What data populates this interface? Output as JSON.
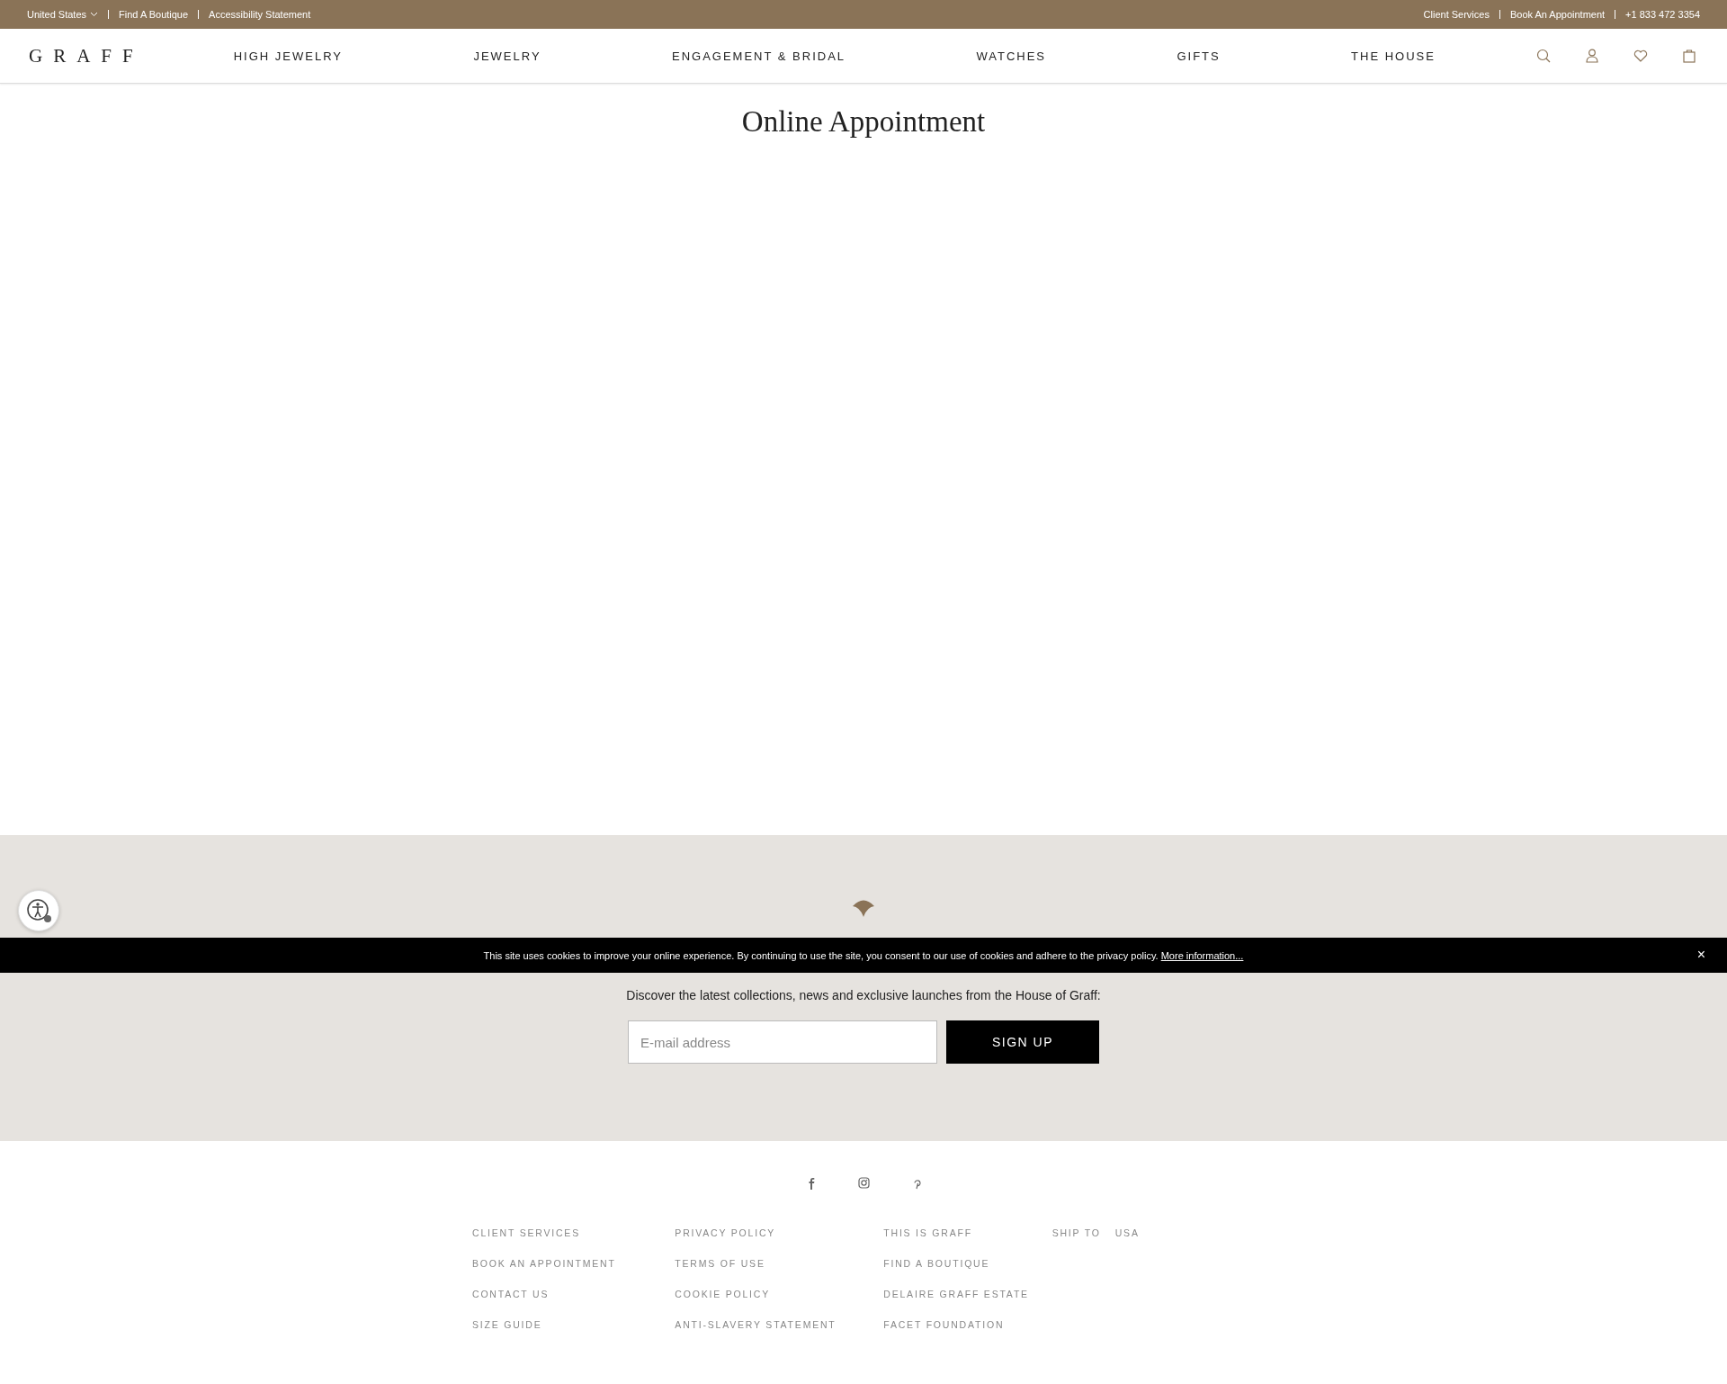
{
  "utility_bar": {
    "left": [
      {
        "kind": "dropdown",
        "label": "United States"
      },
      {
        "kind": "link",
        "label": "Find A Boutique"
      },
      {
        "kind": "link",
        "label": "Accessibility Statement"
      }
    ],
    "right": [
      {
        "kind": "link",
        "label": "Client Services"
      },
      {
        "kind": "link",
        "label": "Book An Appointment"
      },
      {
        "kind": "link",
        "label": "+1 833 472 3354"
      }
    ]
  },
  "header": {
    "logo": "GRAFF",
    "nav": [
      "HIGH JEWELRY",
      "JEWELRY",
      "ENGAGEMENT & BRIDAL",
      "WATCHES",
      "GIFTS",
      "THE HOUSE"
    ]
  },
  "page_title": "Online Appointment",
  "newsletter": {
    "text": "Discover the latest collections, news and exclusive launches from the House of Graff:",
    "email": {
      "placeholder": "E-mail address"
    },
    "button": "SIGN UP"
  },
  "cookie_bar": {
    "text": "This site uses cookies to improve your online experience. By continuing to use the site, you consent to our use of cookies and adhere to the privacy policy.",
    "link": "More information...",
    "close": "×"
  },
  "footer": {
    "columns": [
      [
        "CLIENT SERVICES",
        "BOOK AN APPOINTMENT",
        "CONTACT US",
        "SIZE GUIDE"
      ],
      [
        "PRIVACY POLICY",
        "TERMS OF USE",
        "COOKIE POLICY",
        "ANTI-SLAVERY STATEMENT"
      ],
      [
        "THIS IS GRAFF",
        "FIND A BOUTIQUE",
        "DELAIRE GRAFF ESTATE",
        "FACET FOUNDATION"
      ]
    ],
    "ship_to": {
      "label": "SHIP TO",
      "value": "USA"
    }
  }
}
